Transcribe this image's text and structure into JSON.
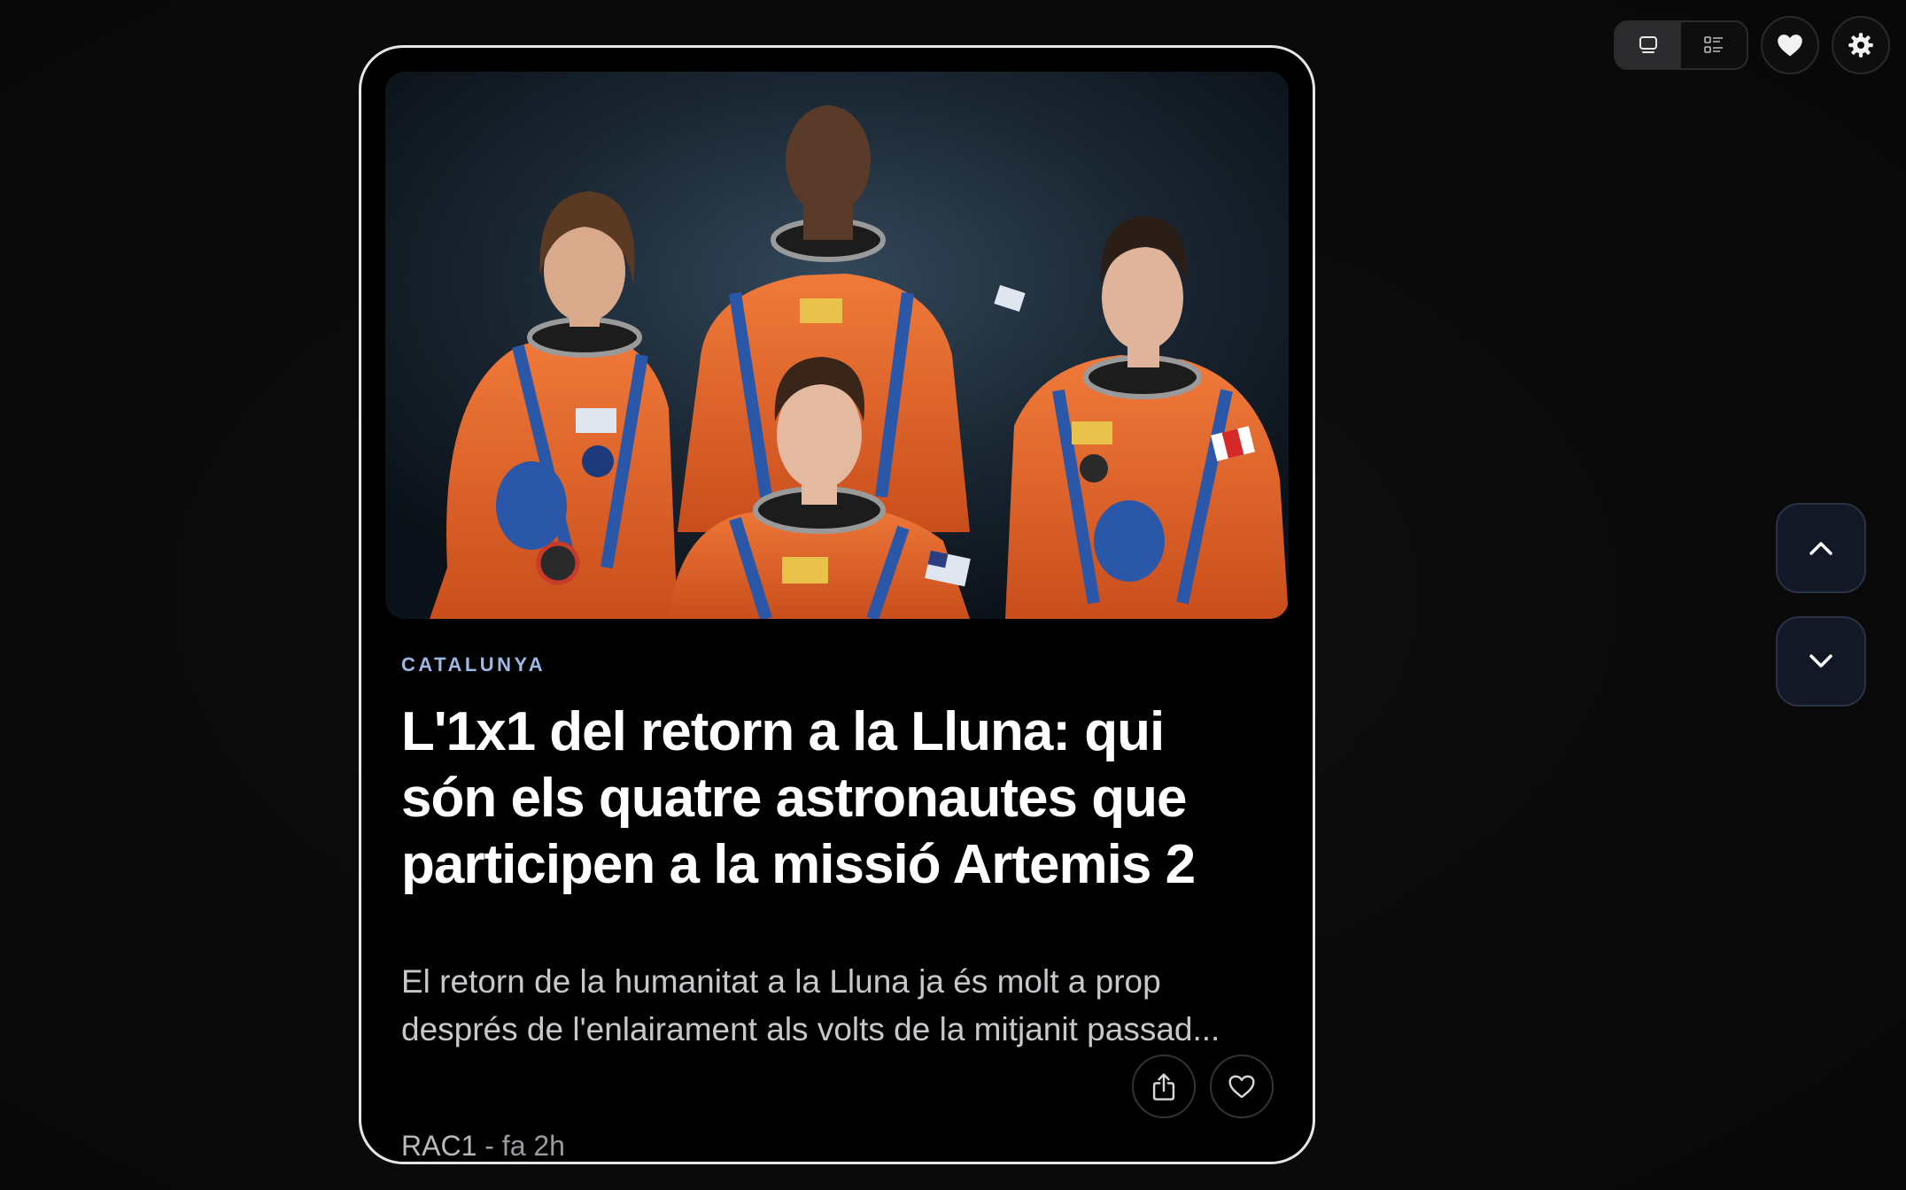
{
  "toolbar": {
    "view_modes": [
      {
        "name": "card-view",
        "icon": "card-view-icon",
        "active": true
      },
      {
        "name": "list-view",
        "icon": "list-view-icon",
        "active": false
      }
    ],
    "favorites_icon": "heart-filled-icon",
    "settings_icon": "gear-icon"
  },
  "navigation": {
    "up_icon": "chevron-up-icon",
    "down_icon": "chevron-down-icon"
  },
  "article": {
    "image_description_icon": "astronaut-crew-photo",
    "category": "CATALUNYA",
    "headline": "L'1x1 del retorn a la Lluna: qui són els quatre astronautes que participen a la missió Artemis 2",
    "summary": "El retorn de la humanitat a la Lluna ja és molt a prop després de l'enlairament als volts de la mitjanit passad...",
    "source": "RAC1",
    "separator": " - ",
    "time": "fa 2h",
    "share_icon": "share-icon",
    "like_icon": "heart-outline-icon"
  },
  "colors": {
    "background": "#0a0a0a",
    "card_border": "#e6e6e6",
    "category": "#9db8e2",
    "headline": "#ffffff",
    "summary": "#c8c8cc",
    "nav_button_bg": "#121826",
    "suit_orange": "#e0642a",
    "suit_blue": "#2b57a8"
  }
}
